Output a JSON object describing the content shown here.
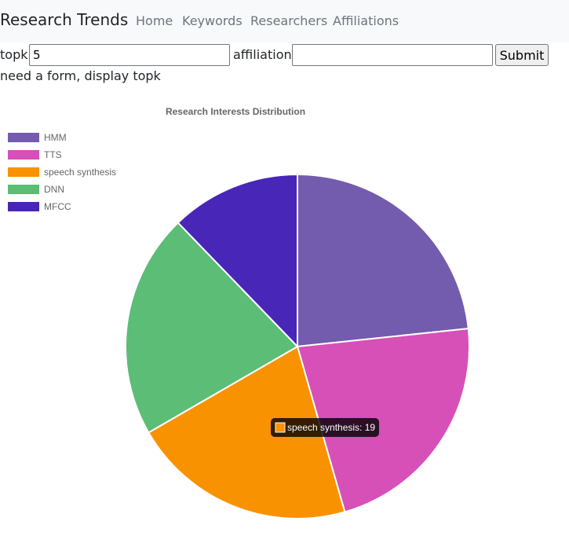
{
  "navbar": {
    "brand": "Research Trends",
    "links": [
      "Home",
      "Keywords",
      "Researchers",
      "Affiliations"
    ]
  },
  "form": {
    "topk_label": "topk:",
    "topk_value": "5",
    "affiliation_label": "affiliation:",
    "affiliation_value": "",
    "submit_label": "Submit"
  },
  "note": "need a form, display topk",
  "chart_data": {
    "type": "pie",
    "title": "Research Interests Distribution",
    "legend_position": "top-left",
    "categories": [
      "HMM",
      "TTS",
      "speech synthesis",
      "DNN",
      "MFCC"
    ],
    "values": [
      21,
      20,
      19,
      19,
      11
    ],
    "colors": [
      "#735bae",
      "#d650b8",
      "#f99200",
      "#5bbd76",
      "#4826b7"
    ],
    "tooltip": {
      "label": "speech synthesis: 19",
      "category": "speech synthesis"
    }
  }
}
